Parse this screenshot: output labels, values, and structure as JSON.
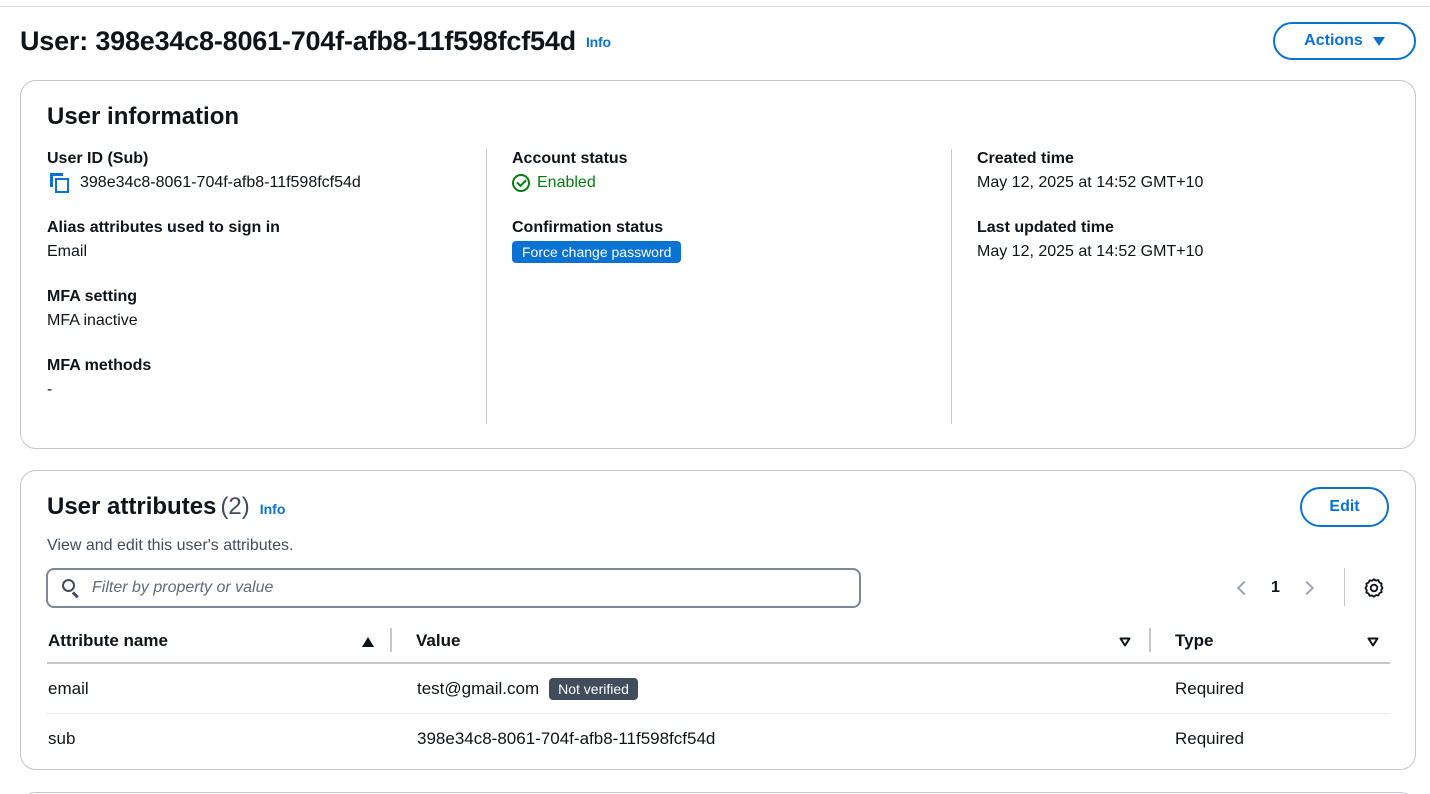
{
  "page": {
    "title": "User: 398e34c8-8061-704f-afb8-11f598fcf54d",
    "info_label": "Info",
    "actions_label": "Actions"
  },
  "user_info": {
    "title": "User information",
    "user_id_label": "User ID (Sub)",
    "user_id_value": "398e34c8-8061-704f-afb8-11f598fcf54d",
    "alias_label": "Alias attributes used to sign in",
    "alias_value": "Email",
    "mfa_setting_label": "MFA setting",
    "mfa_setting_value": "MFA inactive",
    "mfa_methods_label": "MFA methods",
    "mfa_methods_value": "-",
    "account_status_label": "Account status",
    "account_status_value": "Enabled",
    "confirmation_status_label": "Confirmation status",
    "confirmation_status_value": "Force change password",
    "created_time_label": "Created time",
    "created_time_value": "May 12, 2025 at 14:52 GMT+10",
    "last_updated_label": "Last updated time",
    "last_updated_value": "May 12, 2025 at 14:52 GMT+10"
  },
  "user_attributes": {
    "title": "User attributes",
    "count": "(2)",
    "info_label": "Info",
    "description": "View and edit this user's attributes.",
    "edit_label": "Edit",
    "filter_placeholder": "Filter by property or value",
    "current_page": "1",
    "columns": {
      "name": "Attribute name",
      "value": "Value",
      "type": "Type"
    },
    "rows": [
      {
        "name": "email",
        "value": "test@gmail.com",
        "badge": "Not verified",
        "type": "Required"
      },
      {
        "name": "sub",
        "value": "398e34c8-8061-704f-afb8-11f598fcf54d",
        "type": "Required"
      }
    ]
  },
  "icons": {
    "copy": "copy-icon",
    "status_ok": "check-circle-icon",
    "search": "search-icon",
    "settings": "gear-icon",
    "sort_asc": "sort-ascending-icon",
    "sort_neutral": "sort-icon",
    "prev": "chevron-left-icon",
    "next": "chevron-right-icon",
    "dropdown": "caret-down-icon"
  },
  "colors": {
    "accent": "#0972d3",
    "success": "#037f0c",
    "badge_dark": "#414d5c",
    "border": "#c6c6cd"
  }
}
